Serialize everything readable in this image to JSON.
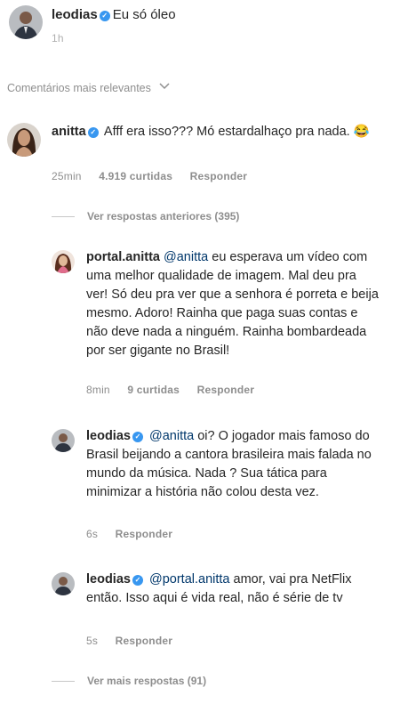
{
  "post": {
    "username": "leodias",
    "caption": "Eu só óleo",
    "time": "1h"
  },
  "comments_header": {
    "label": "Comentários mais relevantes",
    "chevron": "chevron-down-icon"
  },
  "top_comment": {
    "username": "anitta",
    "text": "Afff era isso??? Mó estardalhaço pra nada. 😂",
    "time": "25min",
    "likes": "4.919 curtidas",
    "reply_label": "Responder"
  },
  "view_previous": "Ver respostas anteriores (395)",
  "replies": [
    {
      "username": "portal.anitta",
      "mention": "@anitta",
      "text": "eu esperava um vídeo com uma melhor qualidade de imagem. Mal deu pra ver! Só deu pra ver que a senhora é porreta e beija mesmo. Adoro! Rainha que paga suas contas e não deve nada a ninguém. Rainha bombardeada por ser gigante no Brasil!",
      "time": "8min",
      "likes": "9 curtidas",
      "reply_label": "Responder"
    },
    {
      "username": "leodias",
      "mention": "@anitta",
      "text": "oi? O jogador mais famoso do Brasil beijando a cantora brasileira mais falada no mundo da música. Nada ? Sua tática para minimizar a história não colou desta vez.",
      "time": "6s",
      "reply_label": "Responder"
    },
    {
      "username": "leodias",
      "mention": "@portal.anitta",
      "text": "amor, vai pra NetFlix então. Isso aqui é vida real, não é série de tv",
      "time": "5s",
      "reply_label": "Responder"
    }
  ],
  "view_more": "Ver mais respostas (91)",
  "colors": {
    "verified": "#3897f0",
    "mention": "#00376b",
    "muted": "#8e8e8e"
  }
}
